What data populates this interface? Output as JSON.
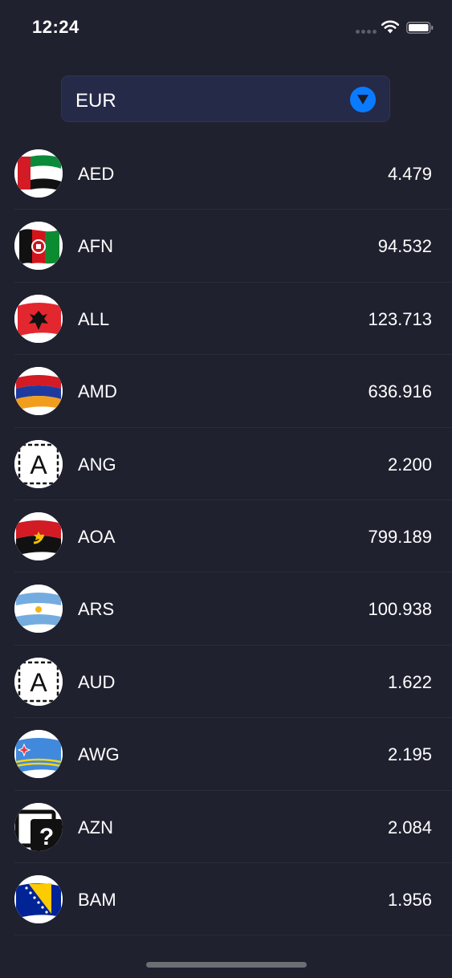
{
  "status_bar": {
    "time": "12:24",
    "wifi_icon": "wifi-icon",
    "battery_icon": "battery-icon"
  },
  "base_currency": {
    "selected": "EUR",
    "icon": "chevron-down-icon",
    "accent": "#0a7bff"
  },
  "rates": [
    {
      "code": "AED",
      "rate": "4.479",
      "icon": "flag-uae-icon"
    },
    {
      "code": "AFN",
      "rate": "94.532",
      "icon": "flag-afghanistan-icon"
    },
    {
      "code": "ALL",
      "rate": "123.713",
      "icon": "flag-albania-icon"
    },
    {
      "code": "AMD",
      "rate": "636.916",
      "icon": "flag-armenia-icon"
    },
    {
      "code": "ANG",
      "rate": "2.200",
      "icon": "letter-a-placeholder-icon"
    },
    {
      "code": "AOA",
      "rate": "799.189",
      "icon": "flag-angola-icon"
    },
    {
      "code": "ARS",
      "rate": "100.938",
      "icon": "flag-argentina-icon"
    },
    {
      "code": "AUD",
      "rate": "1.622",
      "icon": "letter-a-placeholder-icon"
    },
    {
      "code": "AWG",
      "rate": "2.195",
      "icon": "flag-aruba-icon"
    },
    {
      "code": "AZN",
      "rate": "2.084",
      "icon": "question-mark-icon"
    },
    {
      "code": "BAM",
      "rate": "1.956",
      "icon": "flag-bosnia-icon"
    }
  ]
}
